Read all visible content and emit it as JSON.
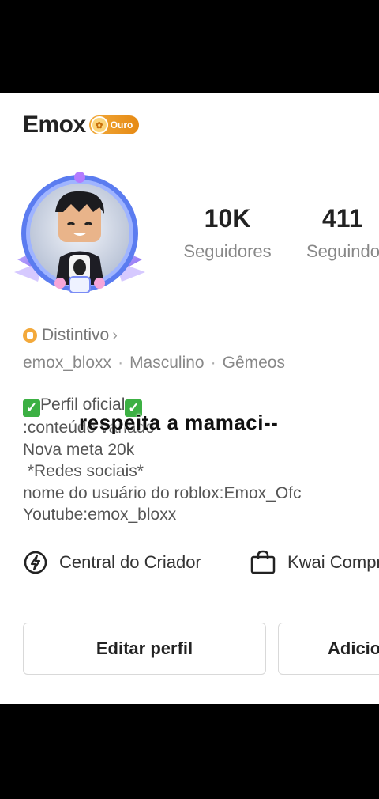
{
  "profile": {
    "name": "Emox",
    "badge_label": "Ouro",
    "followers_count": "10K",
    "followers_label": "Seguidores",
    "following_count": "411",
    "following_label": "Seguindo",
    "distintivo_label": "Distintivo",
    "username": "emox_bloxx",
    "gender": "Masculino",
    "sign": "Gêmeos",
    "bio": {
      "line1": "Perfil oficial",
      "line2": ":conteúdo variado",
      "line3": "Nova meta 20k",
      "line4": " *Redes sociais*",
      "line5": "nome do usuário do roblox:Emox_Ofc",
      "line6": "Youtube:emox_bloxx"
    }
  },
  "overlay_caption": "respeita a mamaci--",
  "links": {
    "creator_center": "Central do Criador",
    "kwai_shop": "Kwai Compras"
  },
  "buttons": {
    "edit_profile": "Editar perfil",
    "add": "Adicionar"
  },
  "colors": {
    "badge": "#e68a14",
    "check": "#3cb043",
    "avatar_frame": "#5b7cf0"
  }
}
